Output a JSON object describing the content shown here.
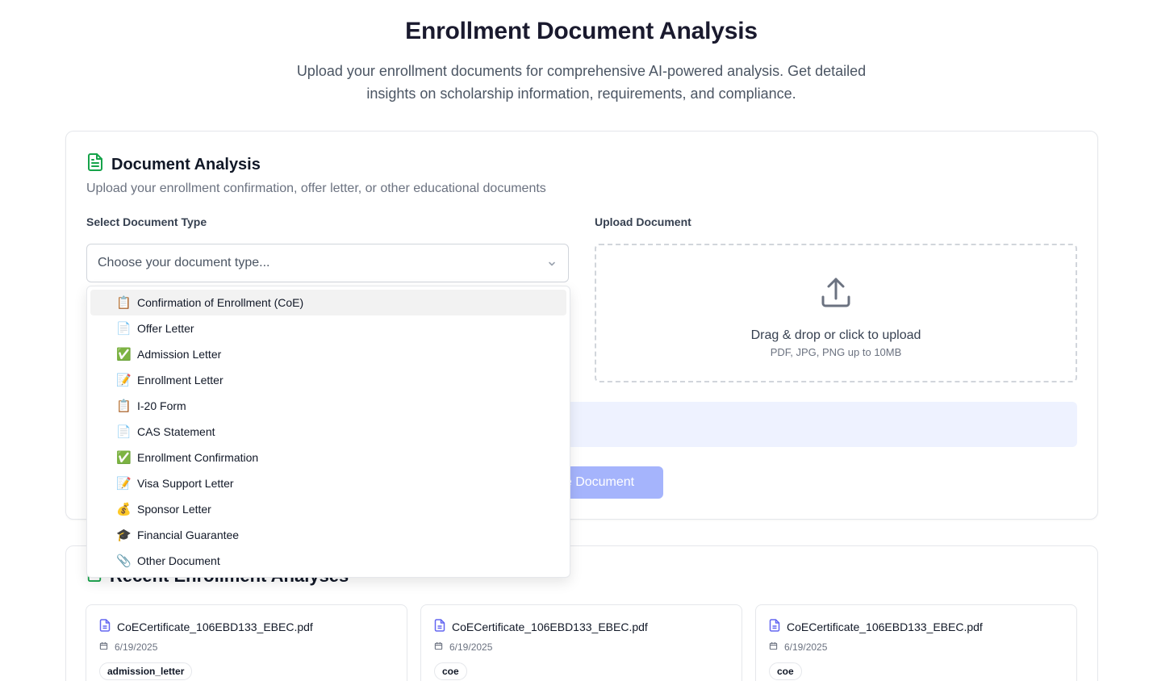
{
  "header": {
    "title": "Enrollment Document Analysis",
    "subtitle": "Upload your enrollment documents for comprehensive AI-powered analysis. Get detailed insights on scholarship information, requirements, and compliance."
  },
  "analysis_card": {
    "title": "Document Analysis",
    "description": "Upload your enrollment confirmation, offer letter, or other educational documents",
    "select_label": "Select Document Type",
    "select_placeholder": "Choose your document type...",
    "upload_label": "Upload Document",
    "upload_main": "Drag & drop or click to upload",
    "upload_sub": "PDF, JPG, PNG up to 10MB",
    "analyze_button": "Analyze Document",
    "analyze_button_visible": "e Document"
  },
  "dropdown": {
    "items": [
      {
        "emoji": "📋",
        "label": "Confirmation of Enrollment (CoE)"
      },
      {
        "emoji": "📄",
        "label": "Offer Letter"
      },
      {
        "emoji": "✅",
        "label": "Admission Letter"
      },
      {
        "emoji": "📝",
        "label": "Enrollment Letter"
      },
      {
        "emoji": "📋",
        "label": "I-20 Form"
      },
      {
        "emoji": "📄",
        "label": "CAS Statement"
      },
      {
        "emoji": "✅",
        "label": "Enrollment Confirmation"
      },
      {
        "emoji": "📝",
        "label": "Visa Support Letter"
      },
      {
        "emoji": "💰",
        "label": "Sponsor Letter"
      },
      {
        "emoji": "🎓",
        "label": "Financial Guarantee"
      },
      {
        "emoji": "📎",
        "label": "Other Document"
      }
    ]
  },
  "recent": {
    "title": "Recent Enrollment Analyses",
    "items": [
      {
        "file": "CoECertificate_106EBD133_EBEC.pdf",
        "date": "6/19/2025",
        "tag": "admission_letter"
      },
      {
        "file": "CoECertificate_106EBD133_EBEC.pdf",
        "date": "6/19/2025",
        "tag": "coe"
      },
      {
        "file": "CoECertificate_106EBD133_EBEC.pdf",
        "date": "6/19/2025",
        "tag": "coe"
      }
    ]
  },
  "colors": {
    "accent": "#a5b4fc",
    "icon_green": "#16a34a",
    "icon_indigo": "#6366f1",
    "info_bg": "#eef2ff"
  }
}
